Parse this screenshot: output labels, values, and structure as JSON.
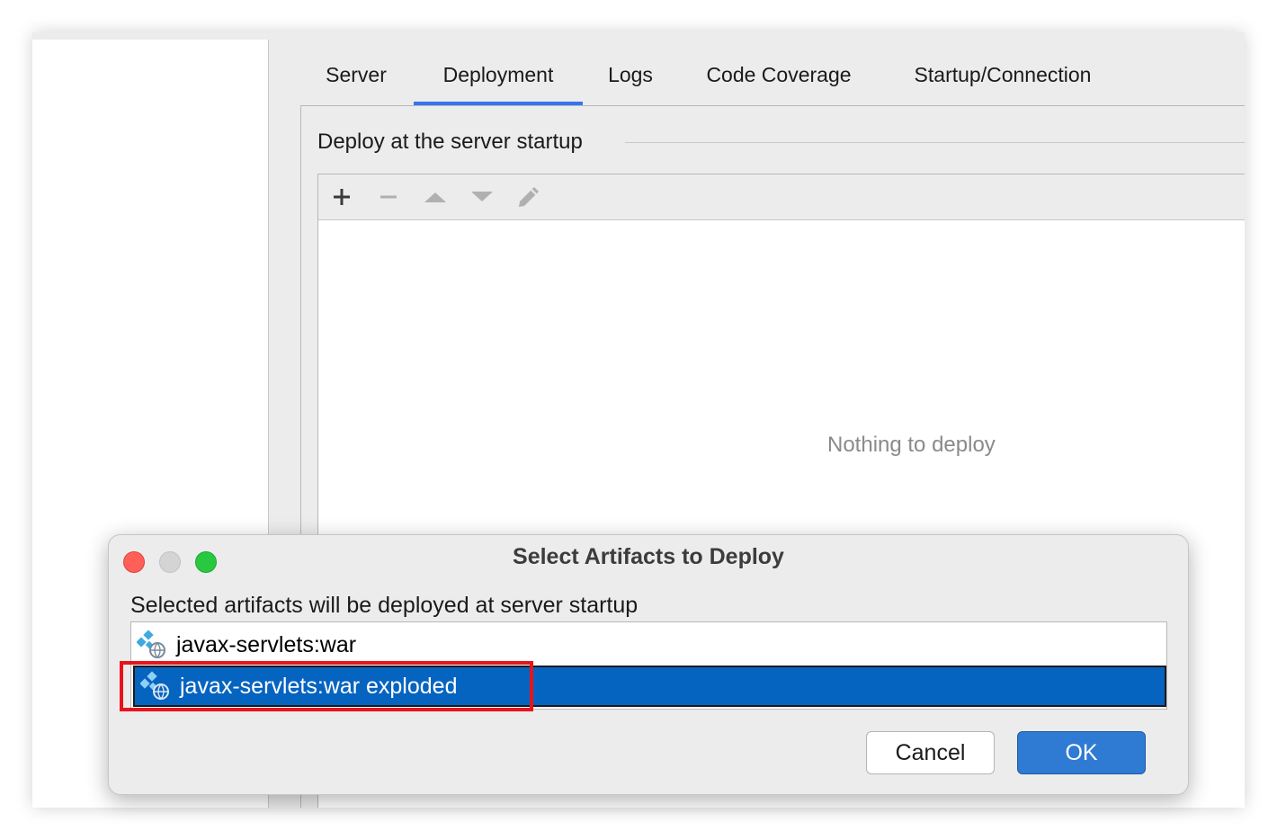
{
  "tabs": [
    "Server",
    "Deployment",
    "Logs",
    "Code Coverage",
    "Startup/Connection"
  ],
  "active_tab": "Deployment",
  "deployment": {
    "group_title": "Deploy at the server startup",
    "toolbar_icons": [
      "add-icon",
      "remove-icon",
      "move-up-icon",
      "move-down-icon",
      "edit-icon"
    ],
    "empty_text": "Nothing to deploy"
  },
  "dialog": {
    "title": "Select Artifacts to Deploy",
    "description": "Selected artifacts will be deployed at server startup",
    "artifacts": [
      {
        "label": "javax-servlets:war",
        "selected": false
      },
      {
        "label": "javax-servlets:war exploded",
        "selected": true
      }
    ],
    "cancel_label": "Cancel",
    "ok_label": "OK"
  },
  "colors": {
    "accent": "#3574f0",
    "selection": "#0664c1",
    "highlight_box": "#e8131b",
    "ok_button": "#2f7ad3",
    "close": "#fe5f57",
    "minimize_inactive": "#d4d4d4",
    "zoom": "#28c840"
  }
}
